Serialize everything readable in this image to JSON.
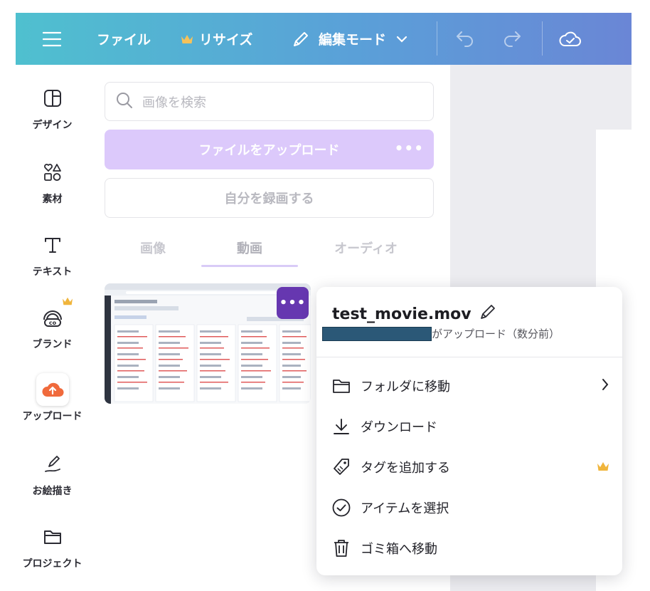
{
  "topbar": {
    "file_label": "ファイル",
    "resize_label": "リサイズ",
    "edit_mode_label": "編集モード"
  },
  "sidebar": {
    "items": [
      {
        "label": "デザイン",
        "icon": "design-icon"
      },
      {
        "label": "素材",
        "icon": "elements-icon"
      },
      {
        "label": "テキスト",
        "icon": "text-icon"
      },
      {
        "label": "ブランド",
        "icon": "brand-icon"
      },
      {
        "label": "アップロード",
        "icon": "upload-cloud-icon"
      },
      {
        "label": "お絵描き",
        "icon": "draw-icon"
      },
      {
        "label": "プロジェクト",
        "icon": "folder-icon"
      }
    ]
  },
  "panel": {
    "search_placeholder": "画像を検索",
    "upload_button": "ファイルをアップロード",
    "upload_more": "•••",
    "record_button": "自分を録画する",
    "tabs": [
      {
        "label": "画像"
      },
      {
        "label": "動画"
      },
      {
        "label": "オーディオ"
      }
    ],
    "thumb_more": "•••"
  },
  "menu": {
    "filename": "test_movie.mov",
    "uploaded_by_suffix": "がアップロード（数分前）",
    "items": [
      {
        "label": "フォルダに移動",
        "icon": "folder-icon"
      },
      {
        "label": "ダウンロード",
        "icon": "download-icon"
      },
      {
        "label": "タグを追加する",
        "icon": "tag-icon"
      },
      {
        "label": "アイテムを選択",
        "icon": "check-circle-icon"
      },
      {
        "label": "ゴミ箱へ移動",
        "icon": "trash-icon"
      }
    ]
  },
  "colors": {
    "accent_purple": "#6637b0",
    "upload_button_bg": "#dcc9fb",
    "crown": "#f0b53c"
  }
}
